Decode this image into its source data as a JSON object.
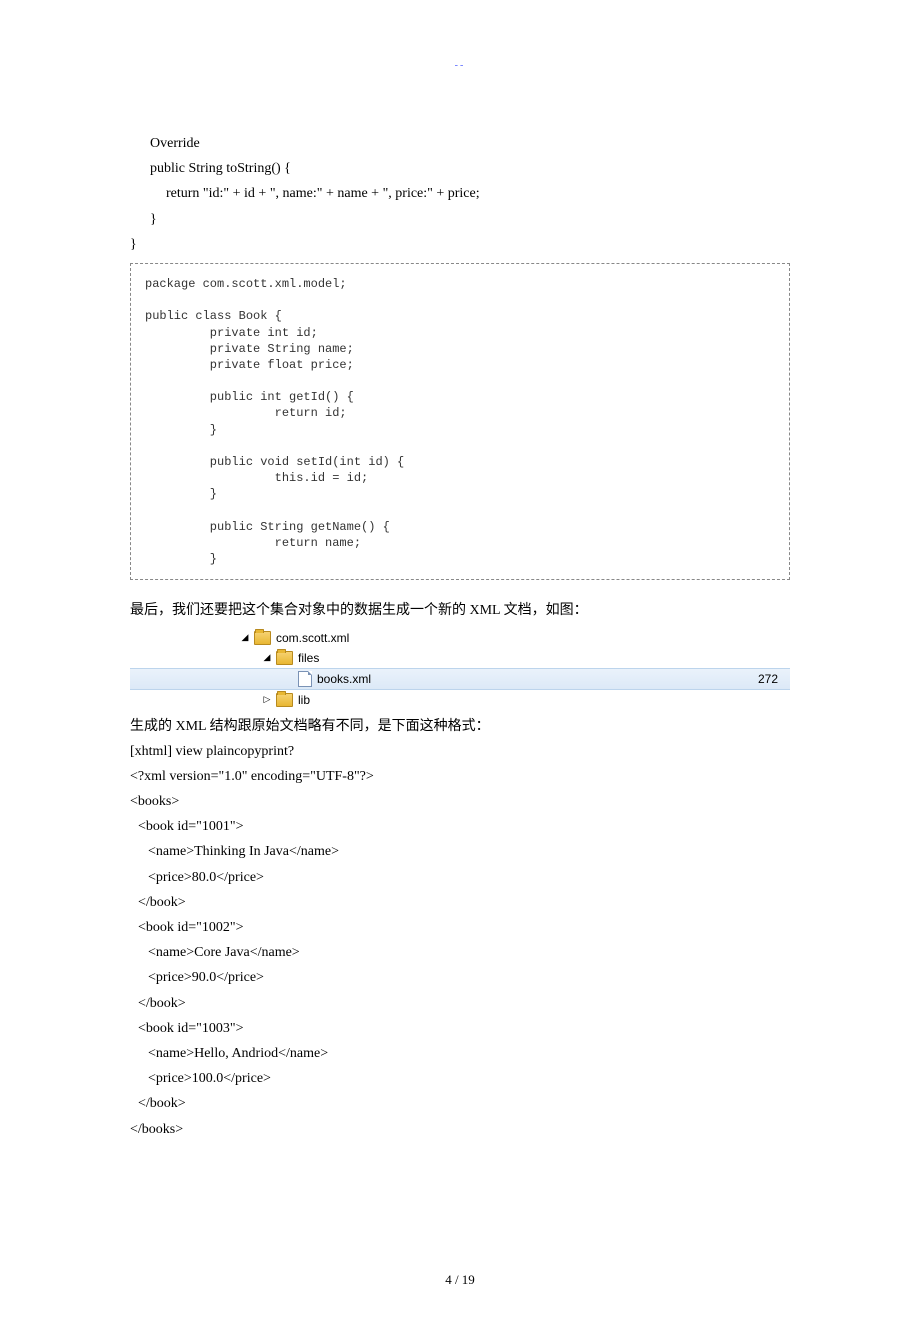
{
  "header_decor": "--",
  "java_top": {
    "l1": "Override",
    "l2": "public String toString() {",
    "l3": "return \"id:\" + id + \", name:\" + name + \", price:\" + price;",
    "l4": "}",
    "l5": "}"
  },
  "code_box": "package com.scott.xml.model;\n\npublic class Book {\n         private int id;\n         private String name;\n         private float price;\n\n         public int getId() {\n                  return id;\n         }\n\n         public void setId(int id) {\n                  this.id = id;\n         }\n\n         public String getName() {\n                  return name;\n         }\n",
  "para1": "最后，我们还要把这个集合对象中的数据生成一个新的 XML 文档，如图：",
  "tree": {
    "row1": "com.scott.xml",
    "row2": "files",
    "row3_name": "books.xml",
    "row3_size": "272",
    "row4": "lib"
  },
  "para2": "生成的 XML 结构跟原始文档略有不同，是下面这种格式：",
  "xml_head": "[xhtml] view plaincopyprint?",
  "xml": [
    "<?xml version=\"1.0\" encoding=\"UTF-8\"?>",
    "<books>",
    "  <book id=\"1001\">",
    "    <name>Thinking In Java</name>",
    "    <price>80.0</price>",
    "  </book>",
    "  <book id=\"1002\">",
    "    <name>Core Java</name>",
    "    <price>90.0</price>",
    "  </book>",
    "  <book id=\"1003\">",
    "    <name>Hello, Andriod</name>",
    "    <price>100.0</price>",
    "  </book>",
    "</books>"
  ],
  "footer": "4  / 19"
}
